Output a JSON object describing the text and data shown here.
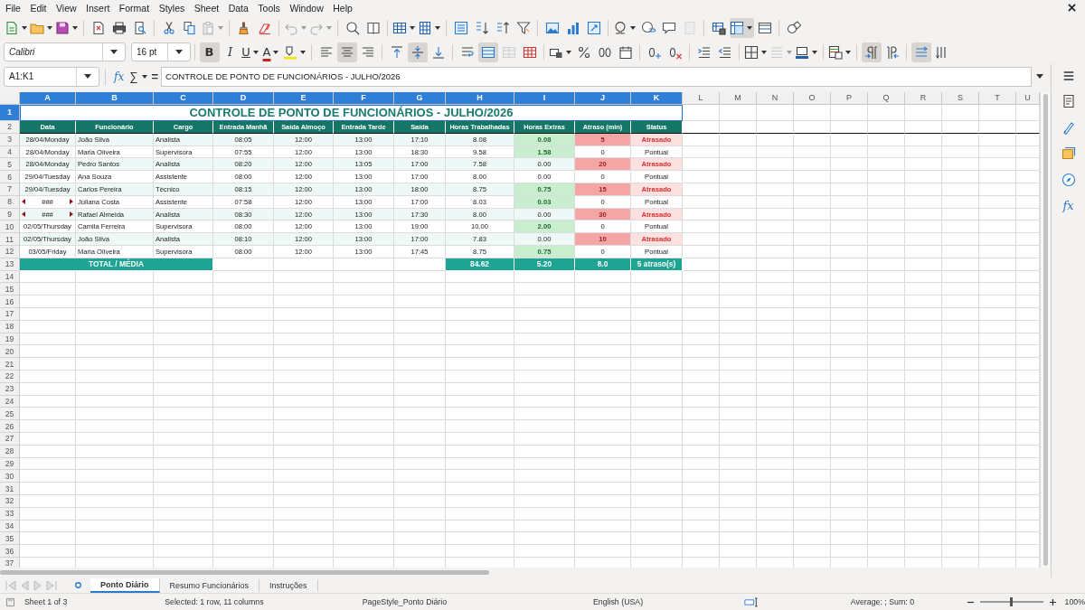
{
  "menu": [
    "File",
    "Edit",
    "View",
    "Insert",
    "Format",
    "Styles",
    "Sheet",
    "Data",
    "Tools",
    "Window",
    "Help"
  ],
  "standard_toolbar": [
    [
      {
        "kind": "new",
        "active": false,
        "disabled": false,
        "dropdown": true
      },
      {
        "kind": "open",
        "active": false,
        "disabled": false,
        "dropdown": true
      },
      {
        "kind": "save",
        "active": false,
        "disabled": false,
        "dropdown": true
      }
    ],
    [
      {
        "kind": "pdf",
        "active": false,
        "disabled": false,
        "dropdown": false
      },
      {
        "kind": "print",
        "active": false,
        "disabled": false,
        "dropdown": false
      },
      {
        "kind": "preview",
        "active": false,
        "disabled": false,
        "dropdown": false
      }
    ],
    [
      {
        "kind": "cut",
        "active": false,
        "disabled": false,
        "dropdown": false
      },
      {
        "kind": "copy",
        "active": false,
        "disabled": false,
        "dropdown": false
      },
      {
        "kind": "paste",
        "active": false,
        "disabled": true,
        "dropdown": true
      }
    ],
    [
      {
        "kind": "clone",
        "active": false,
        "disabled": false,
        "dropdown": false
      },
      {
        "kind": "clear",
        "active": false,
        "disabled": false,
        "dropdown": false
      }
    ],
    [
      {
        "kind": "undo",
        "active": false,
        "disabled": true,
        "dropdown": true
      },
      {
        "kind": "redo",
        "active": false,
        "disabled": true,
        "dropdown": true
      }
    ],
    [
      {
        "kind": "find",
        "active": false,
        "disabled": false,
        "dropdown": false
      },
      {
        "kind": "spell",
        "active": false,
        "disabled": false,
        "dropdown": false
      }
    ],
    [
      {
        "kind": "rows",
        "active": false,
        "disabled": false,
        "dropdown": true
      },
      {
        "kind": "columns",
        "active": false,
        "disabled": false,
        "dropdown": true
      }
    ],
    [
      {
        "kind": "sort",
        "active": false,
        "disabled": false,
        "dropdown": false
      },
      {
        "kind": "sort_asc",
        "active": false,
        "disabled": false,
        "dropdown": false
      },
      {
        "kind": "sort_desc",
        "active": false,
        "disabled": false,
        "dropdown": false
      },
      {
        "kind": "filter",
        "active": false,
        "disabled": false,
        "dropdown": false
      }
    ],
    [
      {
        "kind": "image",
        "active": false,
        "disabled": false,
        "dropdown": false
      },
      {
        "kind": "chart",
        "active": false,
        "disabled": false,
        "dropdown": false
      },
      {
        "kind": "pivot",
        "active": false,
        "disabled": false,
        "dropdown": false
      }
    ],
    [
      {
        "kind": "special",
        "active": false,
        "disabled": false,
        "dropdown": true
      },
      {
        "kind": "link",
        "active": false,
        "disabled": false,
        "dropdown": false
      },
      {
        "kind": "comment",
        "active": false,
        "disabled": false,
        "dropdown": false
      },
      {
        "kind": "headers",
        "active": false,
        "disabled": true,
        "dropdown": false
      }
    ],
    [
      {
        "kind": "print_range",
        "active": false,
        "disabled": false,
        "dropdown": false
      },
      {
        "kind": "freeze",
        "active": true,
        "disabled": false,
        "dropdown": true
      },
      {
        "kind": "split",
        "active": false,
        "disabled": false,
        "dropdown": false
      }
    ],
    [
      {
        "kind": "shapes",
        "active": false,
        "disabled": false,
        "dropdown": false
      }
    ]
  ],
  "font_name": "Calibri",
  "font_size": "16 pt",
  "format_toolbar": [
    [
      {
        "kind": "bold",
        "label": "B",
        "active": true,
        "disabled": false,
        "dropdown": false
      },
      {
        "kind": "italic",
        "label": "I",
        "active": false,
        "disabled": false,
        "dropdown": false
      },
      {
        "kind": "underline",
        "label": "U",
        "active": false,
        "disabled": false,
        "dropdown": true
      },
      {
        "kind": "font_color",
        "label": "A",
        "active": false,
        "disabled": false,
        "dropdown": true
      },
      {
        "kind": "highlight",
        "active": false,
        "disabled": false,
        "dropdown": true
      }
    ],
    [
      {
        "kind": "align_left",
        "active": false,
        "disabled": false,
        "dropdown": false
      },
      {
        "kind": "align_center",
        "active": true,
        "disabled": false,
        "dropdown": false
      },
      {
        "kind": "align_right",
        "active": false,
        "disabled": false,
        "dropdown": false
      }
    ],
    [
      {
        "kind": "align_top",
        "active": false,
        "disabled": false,
        "dropdown": false
      },
      {
        "kind": "align_middle",
        "active": true,
        "disabled": false,
        "dropdown": false
      },
      {
        "kind": "align_bottom",
        "active": false,
        "disabled": false,
        "dropdown": false
      }
    ],
    [
      {
        "kind": "wrap",
        "active": false,
        "disabled": false,
        "dropdown": false
      },
      {
        "kind": "merge_center",
        "active": true,
        "disabled": false,
        "dropdown": false
      },
      {
        "kind": "merge",
        "active": false,
        "disabled": true,
        "dropdown": false
      },
      {
        "kind": "unmerge",
        "active": false,
        "disabled": false,
        "dropdown": false
      }
    ],
    [
      {
        "kind": "number_format",
        "active": false,
        "disabled": false,
        "dropdown": true
      },
      {
        "kind": "percent",
        "active": false,
        "disabled": false,
        "dropdown": false
      },
      {
        "kind": "decimal",
        "active": false,
        "disabled": false,
        "dropdown": false
      },
      {
        "kind": "date",
        "active": false,
        "disabled": false,
        "dropdown": false
      }
    ],
    [
      {
        "kind": "add_decimal",
        "active": false,
        "disabled": false,
        "dropdown": false
      },
      {
        "kind": "del_decimal",
        "active": false,
        "disabled": false,
        "dropdown": false
      }
    ],
    [
      {
        "kind": "indent",
        "active": false,
        "disabled": false,
        "dropdown": false
      },
      {
        "kind": "outdent",
        "active": false,
        "disabled": false,
        "dropdown": false
      }
    ],
    [
      {
        "kind": "borders",
        "active": false,
        "disabled": false,
        "dropdown": true
      },
      {
        "kind": "border_style",
        "active": false,
        "disabled": true,
        "dropdown": true
      },
      {
        "kind": "border_color",
        "active": false,
        "disabled": false,
        "dropdown": true
      }
    ],
    [
      {
        "kind": "conditional",
        "active": false,
        "disabled": false,
        "dropdown": true
      }
    ],
    [
      {
        "kind": "ltr",
        "active": true,
        "disabled": false,
        "dropdown": false
      },
      {
        "kind": "rtl",
        "active": false,
        "disabled": false,
        "dropdown": false
      }
    ],
    [
      {
        "kind": "text_ltr",
        "active": true,
        "disabled": false,
        "dropdown": false
      },
      {
        "kind": "text_ttb",
        "active": false,
        "disabled": false,
        "dropdown": false
      }
    ]
  ],
  "formula_bar": {
    "name_box": "A1:K1",
    "wizard": "fx",
    "sum": "∑",
    "equals": "=",
    "content": "CONTROLE DE PONTO DE FUNCIONÁRIOS - JULHO/2026"
  },
  "sidebar": [
    {
      "kind": "properties"
    },
    {
      "kind": "styles"
    },
    {
      "kind": "gallery"
    },
    {
      "kind": "navigator"
    },
    {
      "kind": "functions",
      "label": "fx"
    }
  ],
  "columns": [
    {
      "label": "A",
      "selected": true
    },
    {
      "label": "B",
      "selected": true
    },
    {
      "label": "C",
      "selected": true
    },
    {
      "label": "D",
      "selected": true
    },
    {
      "label": "E",
      "selected": true
    },
    {
      "label": "F",
      "selected": true
    },
    {
      "label": "G",
      "selected": true
    },
    {
      "label": "H",
      "selected": true
    },
    {
      "label": "I",
      "selected": true
    },
    {
      "label": "J",
      "selected": true
    },
    {
      "label": "K",
      "selected": true
    },
    {
      "label": "L",
      "selected": false
    },
    {
      "label": "M",
      "selected": false
    },
    {
      "label": "N",
      "selected": false
    },
    {
      "label": "O",
      "selected": false
    },
    {
      "label": "P",
      "selected": false
    },
    {
      "label": "Q",
      "selected": false
    },
    {
      "label": "R",
      "selected": false
    },
    {
      "label": "S",
      "selected": false
    },
    {
      "label": "T",
      "selected": false
    },
    {
      "label": "U",
      "selected": false
    }
  ],
  "row_headers": [
    {
      "label": "1",
      "selected": true
    },
    {
      "label": "2",
      "selected": false
    },
    {
      "label": "3",
      "selected": false
    },
    {
      "label": "4",
      "selected": false
    },
    {
      "label": "5",
      "selected": false
    },
    {
      "label": "6",
      "selected": false
    },
    {
      "label": "7",
      "selected": false
    },
    {
      "label": "8",
      "selected": false
    },
    {
      "label": "9",
      "selected": false
    },
    {
      "label": "10",
      "selected": false
    },
    {
      "label": "11",
      "selected": false
    },
    {
      "label": "12",
      "selected": false
    },
    {
      "label": "13",
      "selected": false
    },
    {
      "label": "14",
      "selected": false
    },
    {
      "label": "15",
      "selected": false
    },
    {
      "label": "16",
      "selected": false
    },
    {
      "label": "17",
      "selected": false
    },
    {
      "label": "18",
      "selected": false
    },
    {
      "label": "19",
      "selected": false
    },
    {
      "label": "20",
      "selected": false
    },
    {
      "label": "21",
      "selected": false
    },
    {
      "label": "22",
      "selected": false
    },
    {
      "label": "23",
      "selected": false
    },
    {
      "label": "24",
      "selected": false
    },
    {
      "label": "25",
      "selected": false
    },
    {
      "label": "26",
      "selected": false
    },
    {
      "label": "27",
      "selected": false
    },
    {
      "label": "28",
      "selected": false
    },
    {
      "label": "29",
      "selected": false
    },
    {
      "label": "30",
      "selected": false
    },
    {
      "label": "31",
      "selected": false
    },
    {
      "label": "32",
      "selected": false
    },
    {
      "label": "33",
      "selected": false
    },
    {
      "label": "34",
      "selected": false
    },
    {
      "label": "35",
      "selected": false
    },
    {
      "label": "36",
      "selected": false
    },
    {
      "label": "37",
      "selected": false
    }
  ],
  "title": {
    "text": "CONTROLE DE PONTO DE FUNCIONÁRIOS - JULHO/2026",
    "selected": true
  },
  "headers": [
    "Data",
    "Funcionário",
    "Cargo",
    "Entrada Manhã",
    "Saída Almoço",
    "Entrada Tarde",
    "Saída",
    "Horas Trabalhadas",
    "Horas Extras",
    "Atraso (min)",
    "Status"
  ],
  "rows": [
    {
      "cells": [
        "28/04/Monday",
        "João Silva",
        "Analista",
        "08:05",
        "12:00",
        "13:00",
        "17:10",
        "8.08",
        "0.08",
        "5",
        "Atrasado"
      ],
      "extra": true,
      "late": true,
      "overflow": false
    },
    {
      "cells": [
        "28/04/Monday",
        "Maria Oliveira",
        "Supervisora",
        "07:55",
        "12:00",
        "13:00",
        "18:30",
        "9.58",
        "1.58",
        "0",
        "Pontual"
      ],
      "extra": true,
      "late": false,
      "overflow": false
    },
    {
      "cells": [
        "28/04/Monday",
        "Pedro Santos",
        "Analista",
        "08:20",
        "12:00",
        "13:05",
        "17:00",
        "7.58",
        "0.00",
        "20",
        "Atrasado"
      ],
      "extra": false,
      "late": true,
      "overflow": false
    },
    {
      "cells": [
        "29/04/Tuesday",
        "Ana Souza",
        "Assistente",
        "08:00",
        "12:00",
        "13:00",
        "17:00",
        "8.00",
        "0.00",
        "0",
        "Pontual"
      ],
      "extra": false,
      "late": false,
      "overflow": false
    },
    {
      "cells": [
        "29/04/Tuesday",
        "Carlos Pereira",
        "Técnico",
        "08:15",
        "12:00",
        "13:00",
        "18:00",
        "8.75",
        "0.75",
        "15",
        "Atrasado"
      ],
      "extra": true,
      "late": true,
      "overflow": false
    },
    {
      "cells": [
        "###",
        "Juliana Costa",
        "Assistente",
        "07:58",
        "12:00",
        "13:00",
        "17:00",
        "8.03",
        "0.03",
        "0",
        "Pontual"
      ],
      "extra": true,
      "late": false,
      "overflow": true
    },
    {
      "cells": [
        "###",
        "Rafael Almeida",
        "Analista",
        "08:30",
        "12:00",
        "13:00",
        "17:30",
        "8.00",
        "0.00",
        "30",
        "Atrasado"
      ],
      "extra": false,
      "late": true,
      "overflow": true
    },
    {
      "cells": [
        "02/05/Thursday",
        "Camila Ferreira",
        "Supervisora",
        "08:00",
        "12:00",
        "13:00",
        "19:00",
        "10.00",
        "2.00",
        "0",
        "Pontual"
      ],
      "extra": true,
      "late": false,
      "overflow": false
    },
    {
      "cells": [
        "02/05/Thursday",
        "João Silva",
        "Analista",
        "08:10",
        "12:00",
        "13:00",
        "17:00",
        "7.83",
        "0.00",
        "10",
        "Atrasado"
      ],
      "extra": false,
      "late": true,
      "overflow": false
    },
    {
      "cells": [
        "03/05/Friday",
        "Maria Oliveira",
        "Supervisora",
        "08:00",
        "12:00",
        "13:00",
        "17:45",
        "8.75",
        "0.75",
        "0",
        "Pontual"
      ],
      "extra": true,
      "late": false,
      "overflow": false
    }
  ],
  "totals": {
    "label": "TOTAL / MÉDIA",
    "values": [
      "84.62",
      "5.20",
      "8.0",
      "5 atraso(s)"
    ]
  },
  "sheet_tabs": [
    {
      "label": "Ponto Diário",
      "selected": true
    },
    {
      "label": "Resumo Funcionários",
      "selected": false
    },
    {
      "label": "Instruções",
      "selected": false
    }
  ],
  "status_bar": {
    "sheet": "Sheet 1 of 3",
    "selection": "Selected: 1 row, 11 columns",
    "page_style": "PageStyle_Ponto Diário",
    "language": "English (USA)",
    "summary": "Average: ; Sum: 0",
    "zoom": "100%",
    "zoom_slider": {
      "level": 0.5
    }
  }
}
